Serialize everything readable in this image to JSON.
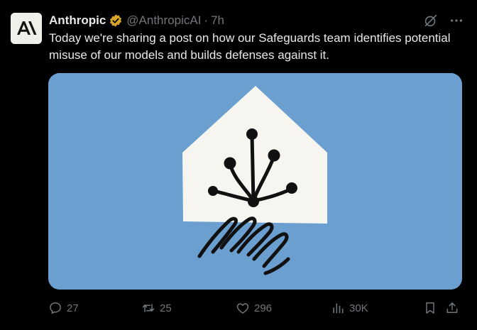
{
  "author": {
    "name": "Anthropic",
    "handle": "@AnthropicAI",
    "separator": "·",
    "time": "7h",
    "avatar_glyph": "A\\",
    "verified_icon": "verified-badge-icon"
  },
  "tweet": {
    "text": "Today we're sharing a post on how our Safeguards team identifies potential misuse of our models and builds defenses against it."
  },
  "media": {
    "background_color": "#6a9fd0",
    "house_color": "#f6f5f0",
    "ink_color": "#111111"
  },
  "actions": {
    "reply_count": "27",
    "retweet_count": "25",
    "like_count": "296",
    "views_count": "30K"
  },
  "colors": {
    "background": "#000000",
    "text": "#e7e9ea",
    "muted": "#71767b",
    "verified_gold": "#d6a52a"
  }
}
